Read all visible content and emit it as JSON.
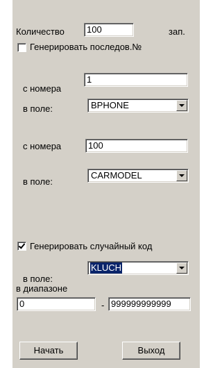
{
  "count": {
    "label": "Количество",
    "value": "100",
    "unit": "зап."
  },
  "sequential": {
    "label": "Генерировать последов.№",
    "checked": false
  },
  "seq1": {
    "from_label": "с номера",
    "from_value": "1",
    "field_label": "в поле:",
    "field_value": "BPHONE"
  },
  "seq2": {
    "from_label": "с номера",
    "from_value": "100",
    "field_label": "в поле:",
    "field_value": "CARMODEL"
  },
  "random": {
    "label": "Генерировать случайный код",
    "checked": true
  },
  "random_field": {
    "field_label": "в поле:",
    "field_value": "KLUCH"
  },
  "range": {
    "label": "в диапазоне",
    "from": "0",
    "separator": "-",
    "to": "999999999999"
  },
  "buttons": {
    "start": "Начать",
    "exit": "Выход"
  }
}
